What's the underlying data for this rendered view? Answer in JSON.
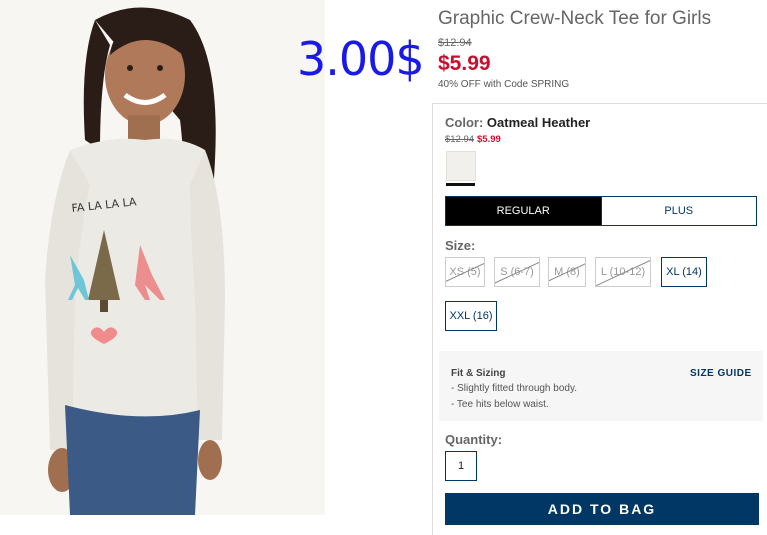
{
  "overlay": {
    "price": "3.00$"
  },
  "product": {
    "title": "Graphic Crew-Neck Tee for Girls",
    "old_price": "$12.94",
    "sale_price": "$5.99",
    "promo": "40% OFF with Code SPRING",
    "shirt_graphic_text": "FA LA LA LA"
  },
  "color": {
    "label": "Color:",
    "name": "Oatmeal Heather",
    "old_price": "$12.94",
    "sale_price": "$5.99"
  },
  "fit_toggle": {
    "regular": "REGULAR",
    "plus": "PLUS",
    "selected": "REGULAR"
  },
  "size": {
    "label": "Size:",
    "options": [
      {
        "label": "XS (5)",
        "available": false
      },
      {
        "label": "S (6-7)",
        "available": false
      },
      {
        "label": "M (8)",
        "available": false
      },
      {
        "label": "L (10-12)",
        "available": false
      },
      {
        "label": "XL (14)",
        "available": true
      },
      {
        "label": "XXL (16)",
        "available": true
      }
    ]
  },
  "fit_sizing": {
    "title": "Fit & Sizing",
    "guide_link": "SIZE GUIDE",
    "items": [
      "- Slightly fitted through body.",
      "- Tee hits below waist."
    ]
  },
  "quantity": {
    "label": "Quantity:",
    "value": "1"
  },
  "add_to_bag": "ADD TO BAG",
  "colors": {
    "accent": "#003764",
    "sale_red": "#c8102e",
    "overlay_blue": "#1a1ae6"
  }
}
